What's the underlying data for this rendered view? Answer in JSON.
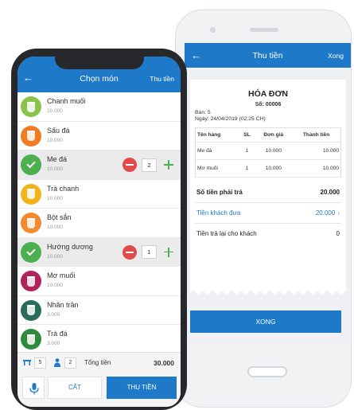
{
  "invoice_screen": {
    "header": {
      "title": "Thu tiền",
      "done_label": "Xong"
    },
    "receipt": {
      "title": "HÓA ĐƠN",
      "number_label": "Số:",
      "number": "00006",
      "table_label": "Bàn:",
      "table": "5",
      "date_label": "Ngày:",
      "date": "24/04/2019 (02:25 CH)",
      "columns": [
        "Tên hàng",
        "SL",
        "Đơn giá",
        "Thành tiền"
      ],
      "rows": [
        [
          "Me đá",
          "1",
          "10.000",
          "10.000"
        ],
        [
          "Mơ muối",
          "1",
          "10.000",
          "10.000"
        ]
      ],
      "total_label": "Số tiền phải trả",
      "total_value": "20.000",
      "paid_label": "Tiền khách đưa",
      "paid_value": "20.000",
      "change_label": "Tiền trả lại cho khách",
      "change_value": "0"
    },
    "confirm_button": "XONG"
  },
  "menu_screen": {
    "header": {
      "title": "Chọn món",
      "pay_label": "Thu tiền"
    },
    "items": [
      {
        "name": "Chanh muối",
        "price": "10.000",
        "color": "#8bc34a",
        "selected": false
      },
      {
        "name": "Sấu đá",
        "price": "10.000",
        "color": "#f07b22",
        "selected": false
      },
      {
        "name": "Me đá",
        "price": "10.000",
        "color": "#4cb050",
        "selected": true,
        "qty": "2"
      },
      {
        "name": "Trà chanh",
        "price": "10.000",
        "color": "#f2b31b",
        "selected": false
      },
      {
        "name": "Bột sắn",
        "price": "10.000",
        "color": "#f28a2e",
        "selected": false
      },
      {
        "name": "Hướng dương",
        "price": "10.000",
        "color": "#4cb050",
        "selected": true,
        "qty": "1"
      },
      {
        "name": "Mơ muối",
        "price": "10.000",
        "color": "#b0245c",
        "selected": false
      },
      {
        "name": "Nhân trần",
        "price": "3.000",
        "color": "#2a6b5a",
        "selected": false
      },
      {
        "name": "Trà đá",
        "price": "3.000",
        "color": "#2e8b3e",
        "selected": false
      }
    ],
    "summary": {
      "table_no": "5",
      "guests": "2",
      "total_label": "Tổng tiền",
      "total_value": "30.000"
    },
    "actions": {
      "cancel": "CẤT",
      "pay": "THU TIỀN"
    }
  },
  "colors": {
    "primary": "#1f79c9",
    "accent_green": "#4cb050",
    "danger": "#e24b4b"
  },
  "icons": [
    "back-arrow-icon",
    "cup-icon",
    "check-icon",
    "minus-icon",
    "plus-icon",
    "table-icon",
    "person-icon",
    "microphone-icon"
  ]
}
